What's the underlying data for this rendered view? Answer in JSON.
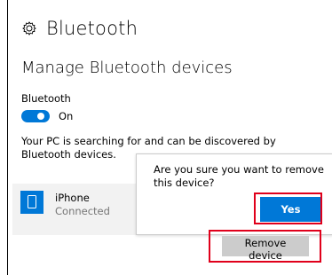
{
  "header": {
    "title": "Bluetooth",
    "icon": "gear-icon"
  },
  "section": {
    "title": "Manage Bluetooth devices"
  },
  "bluetooth": {
    "label": "Bluetooth",
    "state": "On",
    "toggle_color": "#0078d7"
  },
  "searching_text": "Your PC is searching for and can be discovered by Bluetooth devices.",
  "device": {
    "name": "iPhone",
    "status": "Connected",
    "icon": "phone-icon"
  },
  "confirm_popup": {
    "message": "Are you sure you want to remove this device?",
    "yes_label": "Yes"
  },
  "remove_button": {
    "label": "Remove device"
  },
  "colors": {
    "accent": "#0078d7",
    "highlight": "#e0001b"
  }
}
